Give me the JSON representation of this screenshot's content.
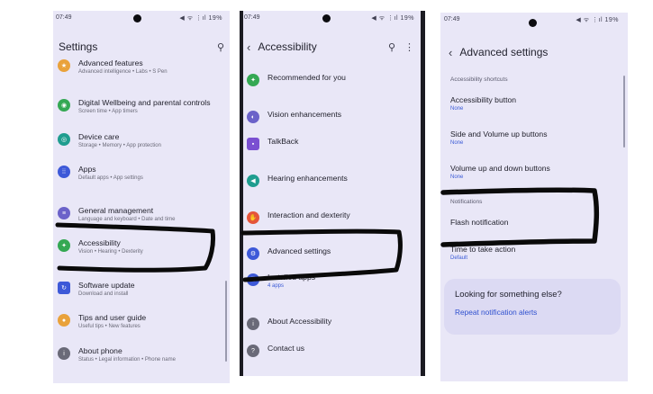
{
  "status": {
    "time": "07:49",
    "icons": "◀ ᯤ ⋮ıl 19%"
  },
  "panel1": {
    "title": "Settings",
    "items": [
      {
        "label": "Advanced features",
        "sub": "Advanced intelligence • Labs • S Pen",
        "icon_color": "#e9a23b",
        "icon": "star-icon"
      },
      {
        "label": "Digital Wellbeing and parental controls",
        "sub": "Screen time • App timers",
        "icon_color": "#34a853",
        "icon": "wellbeing-icon"
      },
      {
        "label": "Device care",
        "sub": "Storage • Memory • App protection",
        "icon_color": "#1f9d8f",
        "icon": "device-care-icon"
      },
      {
        "label": "Apps",
        "sub": "Default apps • App settings",
        "icon_color": "#3d59d8",
        "icon": "apps-icon"
      },
      {
        "label": "General management",
        "sub": "Language and keyboard • Date and time",
        "icon_color": "#6b62c9",
        "icon": "sliders-icon"
      },
      {
        "label": "Accessibility",
        "sub": "Vision • Hearing • Dexterity",
        "icon_color": "#34a853",
        "icon": "accessibility-icon"
      },
      {
        "label": "Software update",
        "sub": "Download and install",
        "icon_color": "#3d59d8",
        "icon": "update-icon"
      },
      {
        "label": "Tips and user guide",
        "sub": "Useful tips • New features",
        "icon_color": "#e9a23b",
        "icon": "bulb-icon"
      },
      {
        "label": "About phone",
        "sub": "Status • Legal information • Phone name",
        "icon_color": "#6a6a78",
        "icon": "info-icon"
      }
    ]
  },
  "panel2": {
    "title": "Accessibility",
    "items": [
      {
        "label": "Recommended for you",
        "sub": "",
        "icon_color": "#34a853",
        "icon": "accessibility-icon"
      },
      {
        "label": "Vision enhancements",
        "sub": "",
        "icon_color": "#6b62c9",
        "icon": "vision-icon"
      },
      {
        "label": "TalkBack",
        "sub": "",
        "icon_color": "#7a4fd1",
        "icon": "talkback-icon"
      },
      {
        "label": "Hearing enhancements",
        "sub": "",
        "icon_color": "#1f9d8f",
        "icon": "hearing-icon"
      },
      {
        "label": "Interaction and dexterity",
        "sub": "",
        "icon_color": "#e5553b",
        "icon": "hand-icon"
      },
      {
        "label": "Advanced settings",
        "sub": "",
        "icon_color": "#3d59d8",
        "icon": "gear-icon"
      },
      {
        "label": "Installed apps",
        "sub": "4 apps",
        "icon_color": "#3d59d8",
        "icon": "apps-icon"
      },
      {
        "label": "About Accessibility",
        "sub": "",
        "icon_color": "#6a6a78",
        "icon": "info-icon"
      },
      {
        "label": "Contact us",
        "sub": "",
        "icon_color": "#6a6a78",
        "icon": "contact-icon"
      }
    ]
  },
  "panel3": {
    "title": "Advanced settings",
    "section_shortcuts": "Accessibility shortcuts",
    "items": [
      {
        "label": "Accessibility button",
        "sub": "None"
      },
      {
        "label": "Side and Volume up buttons",
        "sub": "None"
      },
      {
        "label": "Volume up and down buttons",
        "sub": "None"
      }
    ],
    "section_notifications": "Notifications",
    "items2": [
      {
        "label": "Flash notification",
        "sub": ""
      },
      {
        "label": "Time to take action",
        "sub": "Default"
      }
    ],
    "card": {
      "question": "Looking for something else?",
      "link": "Repeat notification alerts"
    }
  },
  "colors": {
    "background": "#e9e7f7",
    "card": "#dcdaf3",
    "accent": "#2f50cf",
    "scribble": "#0a0a0a"
  }
}
